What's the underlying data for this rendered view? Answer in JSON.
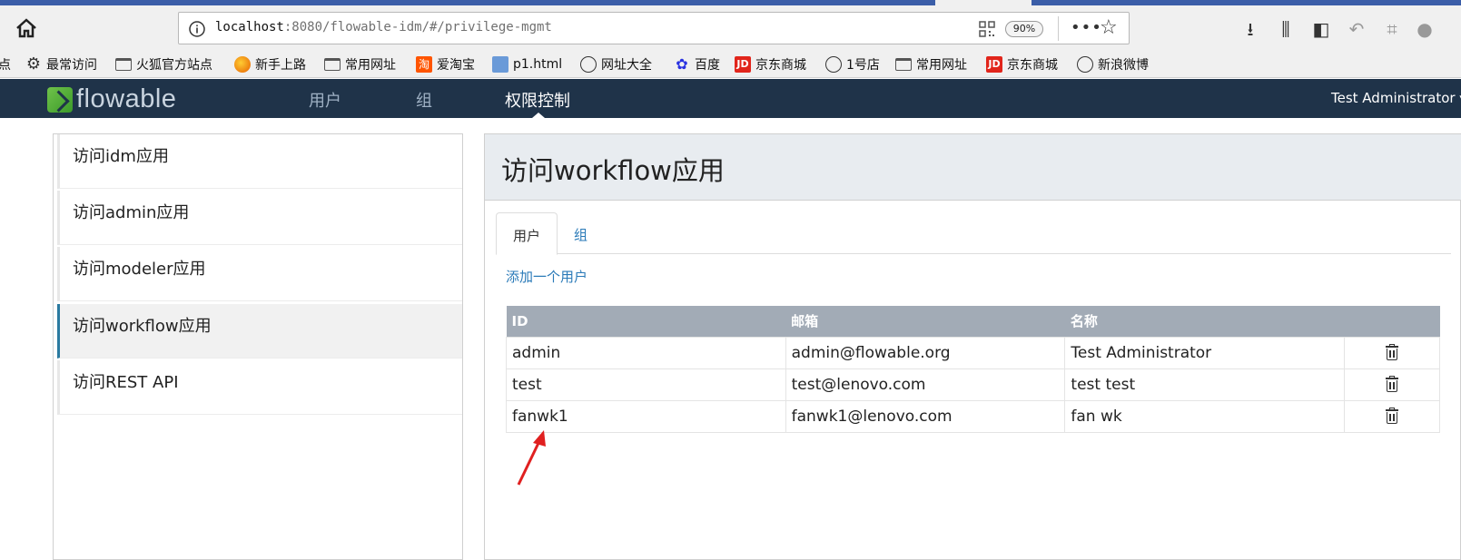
{
  "browser": {
    "url_host": "localhost",
    "url_rest": ":8080/flowable-idm/#/privilege-mgmt",
    "zoom": "90%"
  },
  "bookmarks": [
    {
      "label": "点",
      "icon": "none"
    },
    {
      "label": "最常访问",
      "icon": "gear-icon"
    },
    {
      "label": "火狐官方站点",
      "icon": "folder-icon"
    },
    {
      "label": "新手上路",
      "icon": "firefox-icon"
    },
    {
      "label": "常用网址",
      "icon": "folder-icon"
    },
    {
      "label": "爱淘宝",
      "icon": "taobao-icon"
    },
    {
      "label": "p1.html",
      "icon": "page-icon"
    },
    {
      "label": "网址大全",
      "icon": "globe-icon"
    },
    {
      "label": "百度",
      "icon": "baidu-icon"
    },
    {
      "label": "京东商城",
      "icon": "jd-icon"
    },
    {
      "label": "1号店",
      "icon": "globe-icon"
    },
    {
      "label": "常用网址",
      "icon": "folder-icon"
    },
    {
      "label": "京东商城",
      "icon": "jd-icon"
    },
    {
      "label": "新浪微博",
      "icon": "globe-icon"
    }
  ],
  "app": {
    "logo_text": "flowable",
    "nav": {
      "users": "用户",
      "groups": "组",
      "privileges": "权限控制"
    },
    "user_menu": "Test Administrator ▾"
  },
  "privileges": [
    {
      "label": "访问idm应用",
      "active": false
    },
    {
      "label": "访问admin应用",
      "active": false
    },
    {
      "label": "访问modeler应用",
      "active": false
    },
    {
      "label": "访问workflow应用",
      "active": true
    },
    {
      "label": "访问REST API",
      "active": false
    }
  ],
  "detail": {
    "title": "访问workflow应用",
    "tabs": {
      "users": "用户",
      "groups": "组"
    },
    "add_user": "添加一个用户",
    "columns": {
      "id": "ID",
      "email": "邮箱",
      "name": "名称"
    },
    "rows": [
      {
        "id": "admin",
        "email": "admin@flowable.org",
        "name": "Test Administrator"
      },
      {
        "id": "test",
        "email": "test@lenovo.com",
        "name": "test test"
      },
      {
        "id": "fanwk1",
        "email": "fanwk1@lenovo.com",
        "name": "fan wk"
      }
    ]
  },
  "colors": {
    "header_bg": "#1f3349",
    "accent": "#2a7ab8",
    "annotation_arrow": "#e02020"
  }
}
